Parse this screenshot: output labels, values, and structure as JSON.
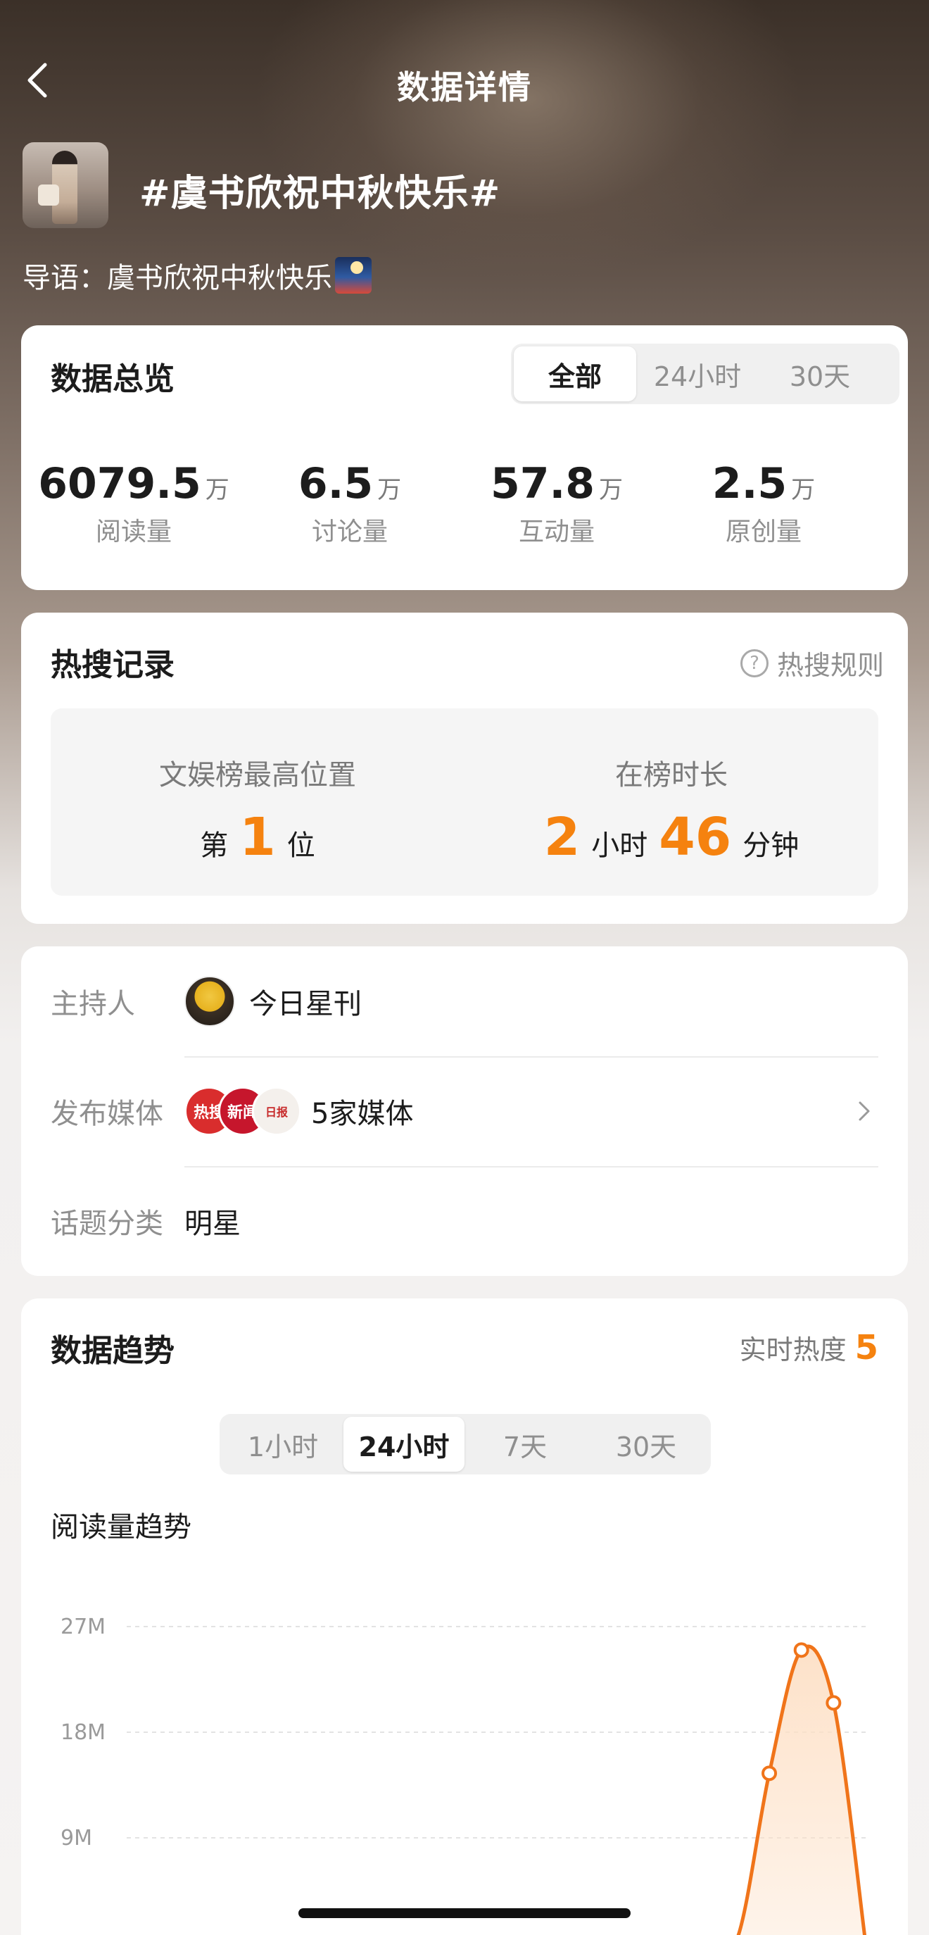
{
  "nav": {
    "title": "数据详情",
    "back_icon": "chevron-left-icon"
  },
  "topic": {
    "title": "#虞书欣祝中秋快乐#",
    "intro": "导语：虞书欣祝中秋快乐"
  },
  "overview": {
    "title": "数据总览",
    "tabs": [
      {
        "label": "全部",
        "active": true
      },
      {
        "label": "24小时",
        "active": false
      },
      {
        "label": "30天",
        "active": false
      }
    ],
    "stats": [
      {
        "value": "6079.5",
        "unit": "万",
        "label": "阅读量"
      },
      {
        "value": "6.5",
        "unit": "万",
        "label": "讨论量"
      },
      {
        "value": "57.8",
        "unit": "万",
        "label": "互动量"
      },
      {
        "value": "2.5",
        "unit": "万",
        "label": "原创量"
      }
    ]
  },
  "hot_search": {
    "title": "热搜记录",
    "rules_label": "热搜规则",
    "best_position_label": "文娱榜最高位置",
    "best_position_prefix": "第",
    "best_position_value": "1",
    "best_position_suffix": "位",
    "duration_label": "在榜时长",
    "duration_hours": "2",
    "duration_hours_unit": "小时",
    "duration_minutes": "46",
    "duration_minutes_unit": "分钟"
  },
  "info": {
    "host_label": "主持人",
    "host_name": "今日星刊",
    "media_label": "发布媒体",
    "media_value": "5家媒体",
    "media_avatar_texts": [
      "热搜",
      "新闻",
      "日报"
    ],
    "category_label": "话题分类",
    "category_value": "明星"
  },
  "trend": {
    "title": "数据趋势",
    "realtime_heat_label": "实时热度",
    "realtime_heat_value": "5",
    "tabs": [
      {
        "label": "1小时",
        "active": false
      },
      {
        "label": "24小时",
        "active": true
      },
      {
        "label": "7天",
        "active": false
      },
      {
        "label": "30天",
        "active": false
      }
    ],
    "chart_title": "阅读量趋势"
  },
  "colors": {
    "accent_orange": "#f5820f",
    "chart_line": "#f0741a",
    "chart_fill": "#fde0c6"
  },
  "chart_data": {
    "type": "area",
    "title": "阅读量趋势",
    "xlabel": "",
    "ylabel": "",
    "ylim": [
      0,
      27
    ],
    "y_ticks": [
      "27M",
      "18M",
      "9M"
    ],
    "y_tick_values": [
      27,
      18,
      9
    ],
    "grid": true,
    "series": [
      {
        "points": [
          {
            "x": 0,
            "y": 0
          },
          {
            "x": 1,
            "y": 0
          },
          {
            "x": 2,
            "y": 0
          },
          {
            "x": 3,
            "y": 0
          },
          {
            "x": 4,
            "y": 0
          },
          {
            "x": 5,
            "y": 0
          },
          {
            "x": 6,
            "y": 0
          },
          {
            "x": 7,
            "y": 0
          },
          {
            "x": 8,
            "y": 0
          },
          {
            "x": 9,
            "y": 0
          },
          {
            "x": 10,
            "y": 0
          },
          {
            "x": 11,
            "y": 0
          },
          {
            "x": 12,
            "y": 0
          },
          {
            "x": 13,
            "y": 0
          },
          {
            "x": 14,
            "y": 0
          },
          {
            "x": 15,
            "y": 0
          },
          {
            "x": 16,
            "y": 0
          },
          {
            "x": 17,
            "y": 0
          },
          {
            "x": 18,
            "y": 0
          },
          {
            "x": 19,
            "y": 0.4
          },
          {
            "x": 20,
            "y": 14.5
          },
          {
            "x": 21,
            "y": 25.0
          },
          {
            "x": 22,
            "y": 20.5
          },
          {
            "x": 23,
            "y": 0
          }
        ],
        "marked_indices": [
          20,
          21,
          22
        ]
      }
    ]
  }
}
